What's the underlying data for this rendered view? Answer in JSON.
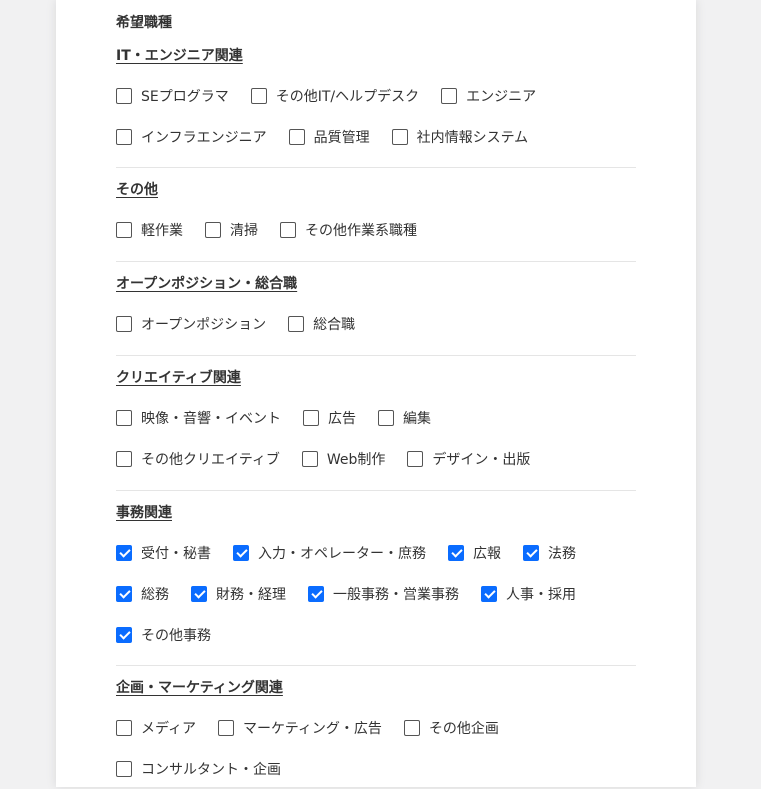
{
  "form": {
    "title": "希望職種",
    "sections": [
      {
        "heading": "IT・エンジニア関連",
        "rows": [
          [
            {
              "label": "SEプログラマ",
              "checked": false
            },
            {
              "label": "その他IT/ヘルプデスク",
              "checked": false
            },
            {
              "label": "エンジニア",
              "checked": false
            }
          ],
          [
            {
              "label": "インフラエンジニア",
              "checked": false
            },
            {
              "label": "品質管理",
              "checked": false
            },
            {
              "label": "社内情報システム",
              "checked": false
            }
          ]
        ]
      },
      {
        "heading": "その他",
        "rows": [
          [
            {
              "label": "軽作業",
              "checked": false
            },
            {
              "label": "清掃",
              "checked": false
            },
            {
              "label": "その他作業系職種",
              "checked": false
            }
          ]
        ]
      },
      {
        "heading": "オープンポジション・総合職",
        "rows": [
          [
            {
              "label": "オープンポジション",
              "checked": false
            },
            {
              "label": "総合職",
              "checked": false
            }
          ]
        ]
      },
      {
        "heading": "クリエイティブ関連",
        "rows": [
          [
            {
              "label": "映像・音響・イベント",
              "checked": false
            },
            {
              "label": "広告",
              "checked": false
            },
            {
              "label": "編集",
              "checked": false
            }
          ],
          [
            {
              "label": "その他クリエイティブ",
              "checked": false
            },
            {
              "label": "Web制作",
              "checked": false
            },
            {
              "label": "デザイン・出版",
              "checked": false
            }
          ]
        ]
      },
      {
        "heading": "事務関連",
        "rows": [
          [
            {
              "label": "受付・秘書",
              "checked": true
            },
            {
              "label": "入力・オペレーター・庶務",
              "checked": true
            },
            {
              "label": "広報",
              "checked": true
            },
            {
              "label": "法務",
              "checked": true
            }
          ],
          [
            {
              "label": "総務",
              "checked": true
            },
            {
              "label": "財務・経理",
              "checked": true
            },
            {
              "label": "一般事務・営業事務",
              "checked": true
            },
            {
              "label": "人事・採用",
              "checked": true
            }
          ],
          [
            {
              "label": "その他事務",
              "checked": true
            }
          ]
        ]
      },
      {
        "heading": "企画・マーケティング関連",
        "rows": [
          [
            {
              "label": "メディア",
              "checked": false
            },
            {
              "label": "マーケティング・広告",
              "checked": false
            },
            {
              "label": "その他企画",
              "checked": false
            }
          ],
          [
            {
              "label": "コンサルタント・企画",
              "checked": false
            }
          ]
        ]
      }
    ],
    "colors": {
      "accent": "#0a6cff",
      "divider": "#e5e5e5",
      "background": "#f1f1f2"
    }
  }
}
